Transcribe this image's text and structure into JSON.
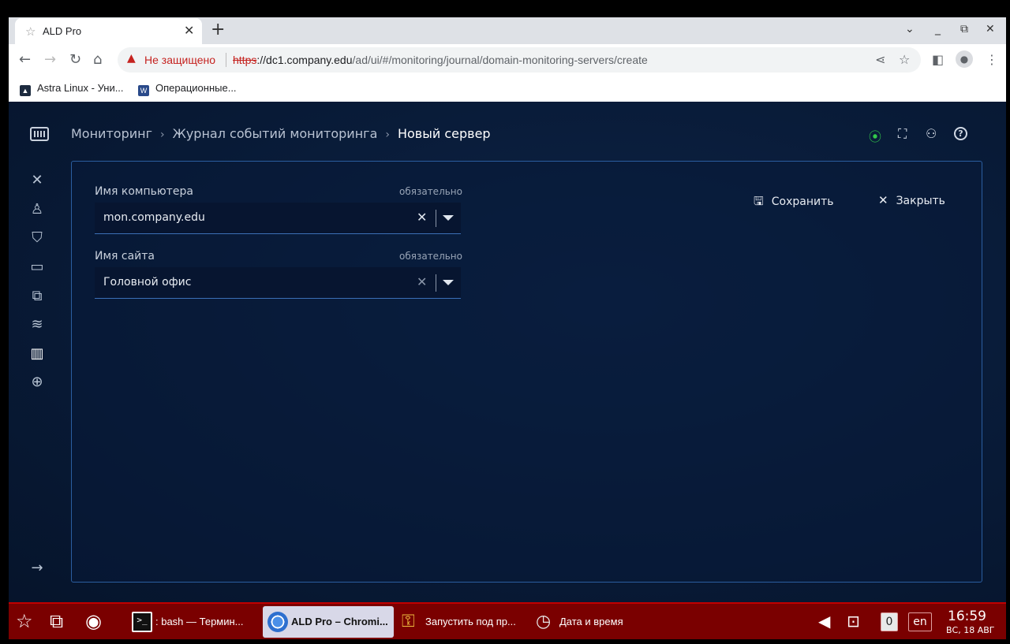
{
  "browser": {
    "tab_title": "ALD Pro",
    "warning_text": "Не защищено",
    "url_scheme": "https",
    "url_host": "://dc1.company.edu",
    "url_path": "/ad/ui/#/monitoring/journal/domain-monitoring-servers/create",
    "bookmarks": [
      "Astra Linux - Уни...",
      "Операционные..."
    ]
  },
  "app": {
    "breadcrumb": [
      "Мониторинг",
      "Журнал событий мониторинга",
      "Новый сервер"
    ],
    "form": {
      "computer_label": "Имя компьютера",
      "computer_required": "обязательно",
      "computer_value": "mon.company.edu",
      "site_label": "Имя сайта",
      "site_required": "обязательно",
      "site_value": "Головной офис"
    },
    "actions": {
      "save": "Сохранить",
      "close": "Закрыть"
    }
  },
  "taskbar": {
    "tasks": [
      ": bash — Термин...",
      "ALD Pro – Chromi...",
      "Запустить под пр...",
      "Дата и время"
    ],
    "badge_count": "0",
    "language": "en",
    "time": "16:59",
    "date": "ВС, 18 АВГ"
  },
  "colors": {
    "accent": "#2b5ea0",
    "taskbar": "#7a0000",
    "status_green": "#32c94a"
  }
}
